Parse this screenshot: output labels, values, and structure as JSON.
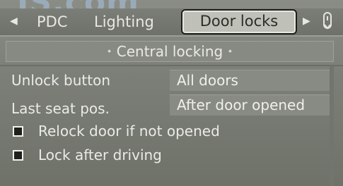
{
  "watermark": "JS.com",
  "tabs": {
    "left_arrow": "◀",
    "right_arrow": "▶",
    "items": [
      "PDC",
      "Lighting",
      "Door locks"
    ],
    "selected": "Door locks"
  },
  "section": {
    "title": "Central locking",
    "dot_left": "•",
    "dot_right": "•"
  },
  "settings": [
    {
      "label": "Unlock button",
      "value": "All doors"
    },
    {
      "label": "Last seat pos.",
      "value": "After door opened"
    }
  ],
  "checkboxes": [
    {
      "label": "Relock door if not opened",
      "checked": false
    },
    {
      "label": "Lock after driving",
      "checked": false
    }
  ],
  "icons": {
    "scroll": "scroll-knob-icon"
  }
}
